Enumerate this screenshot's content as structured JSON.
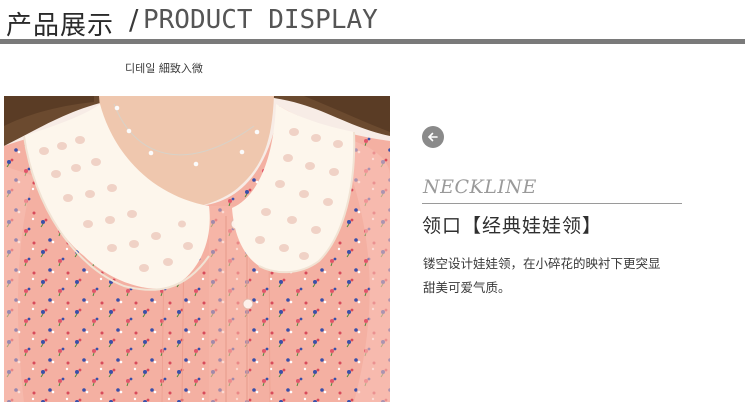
{
  "header": {
    "title_cn": "产品展示",
    "separator": "/",
    "title_en": "PRODUCT DISPLAY"
  },
  "photo": {
    "caption": "디테일 細致入微",
    "icon": "blouse-collar-photo",
    "colors": {
      "fabric": "#f4b0a2",
      "collar": "#fdf6ec",
      "skin": "#efc7ae",
      "hair": "#6b4a2f"
    }
  },
  "detail": {
    "back_icon": "arrow-left-icon",
    "title_en": "NECKLINE",
    "title_cn": "领口【经典娃娃领】",
    "description_lines": [
      "镂空设计娃娃领，在小碎花的映衬下更突显",
      "甜美可爱气质。"
    ]
  },
  "colors": {
    "rule": "#7a7a7a",
    "accent_gray": "#8a8a8a"
  }
}
